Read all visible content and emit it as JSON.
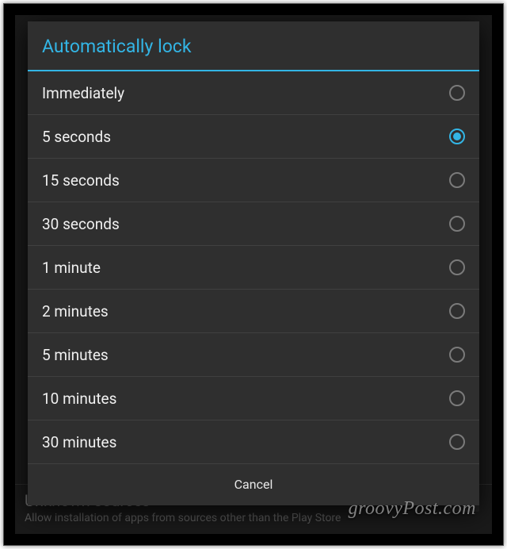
{
  "dialog": {
    "title": "Automatically lock",
    "selected_index": 1,
    "options": [
      "Immediately",
      "5 seconds",
      "15 seconds",
      "30 seconds",
      "1 minute",
      "2 minutes",
      "5 minutes",
      "10 minutes",
      "30 minutes"
    ],
    "cancel_label": "Cancel"
  },
  "background": {
    "title": "Unknown sources",
    "subtitle": "Allow installation of apps from sources other than the Play Store"
  },
  "watermark": "groovyPost.com",
  "colors": {
    "accent": "#33b5e5",
    "dialog_bg": "#2f2f2f",
    "screen_bg": "#1a1a1a"
  }
}
